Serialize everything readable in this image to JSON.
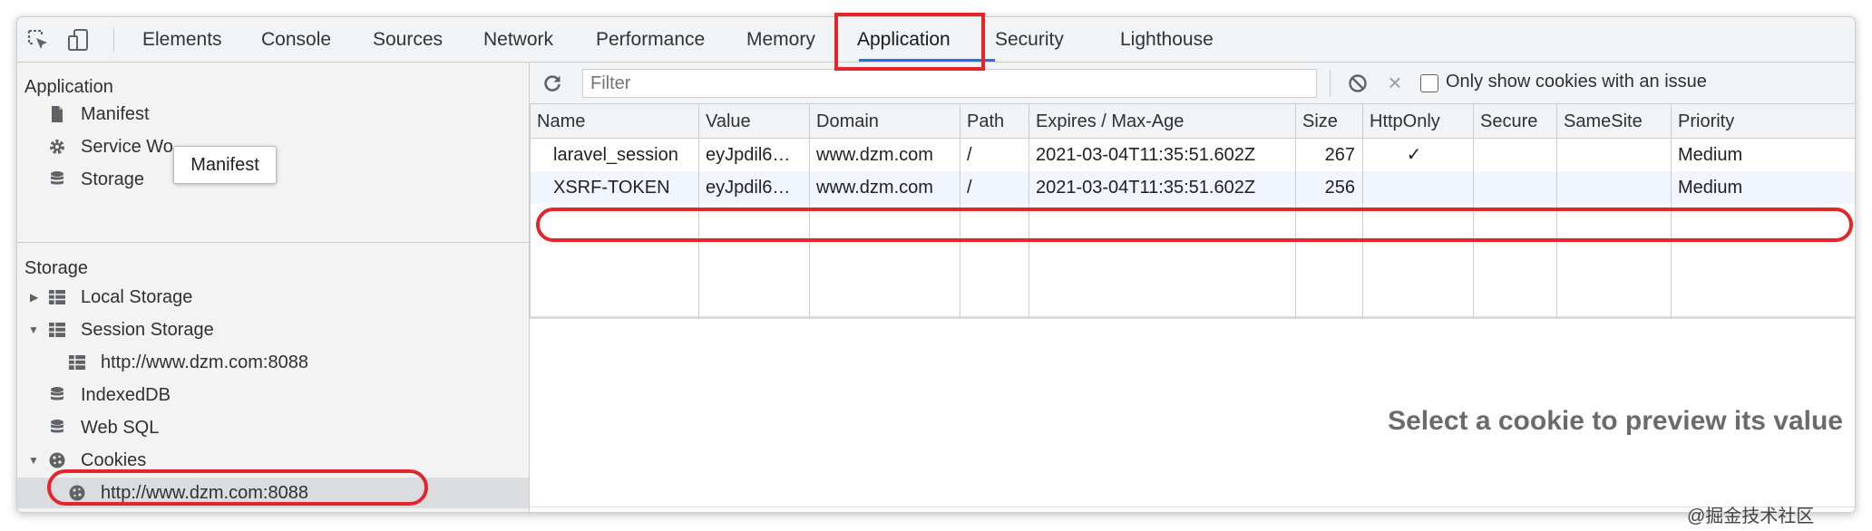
{
  "tabs": [
    {
      "label": "Elements"
    },
    {
      "label": "Console"
    },
    {
      "label": "Sources"
    },
    {
      "label": "Network"
    },
    {
      "label": "Performance"
    },
    {
      "label": "Memory"
    },
    {
      "label": "Application",
      "active": true
    },
    {
      "label": "Security"
    },
    {
      "label": "Lighthouse"
    }
  ],
  "sidebar": {
    "application_title": "Application",
    "application_items": [
      "Manifest",
      "Service Wo",
      "Storage"
    ],
    "storage_title": "Storage",
    "storage_items": [
      {
        "label": "Local Storage",
        "icon": "table-icon",
        "expanded": false
      },
      {
        "label": "Session Storage",
        "icon": "table-icon",
        "expanded": true
      },
      {
        "label": "http://www.dzm.com:8088",
        "icon": "table-icon"
      },
      {
        "label": "IndexedDB",
        "icon": "database-icon"
      },
      {
        "label": "Web SQL",
        "icon": "database-icon"
      },
      {
        "label": "Cookies",
        "icon": "cookie-icon",
        "expanded": true
      },
      {
        "label": "http://www.dzm.com:8088",
        "icon": "cookie-icon",
        "selected": true
      }
    ]
  },
  "tooltip": "Manifest",
  "toolbar": {
    "filter_placeholder": "Filter",
    "only_issue_label": "Only show cookies with an issue"
  },
  "table": {
    "columns": [
      "Name",
      "Value",
      "Domain",
      "Path",
      "Expires / Max-Age",
      "Size",
      "HttpOnly",
      "Secure",
      "SameSite",
      "Priority"
    ],
    "rows": [
      {
        "name": "laravel_session",
        "value": "eyJpdil6…",
        "domain": "www.dzm.com",
        "path": "/",
        "expires": "2021-03-04T11:35:51.602Z",
        "size": "267",
        "httponly": "✓",
        "secure": "",
        "samesite": "",
        "priority": "Medium"
      },
      {
        "name": "XSRF-TOKEN",
        "value": "eyJpdil6…",
        "domain": "www.dzm.com",
        "path": "/",
        "expires": "2021-03-04T11:35:51.602Z",
        "size": "256",
        "httponly": "",
        "secure": "",
        "samesite": "",
        "priority": "Medium"
      }
    ]
  },
  "preview_message": "Select a cookie to preview its value",
  "watermark": "@掘金技术社区",
  "colors": {
    "accent": "#1a73e8",
    "annotation": "#e3262b",
    "selected_row": "#dadce0"
  }
}
